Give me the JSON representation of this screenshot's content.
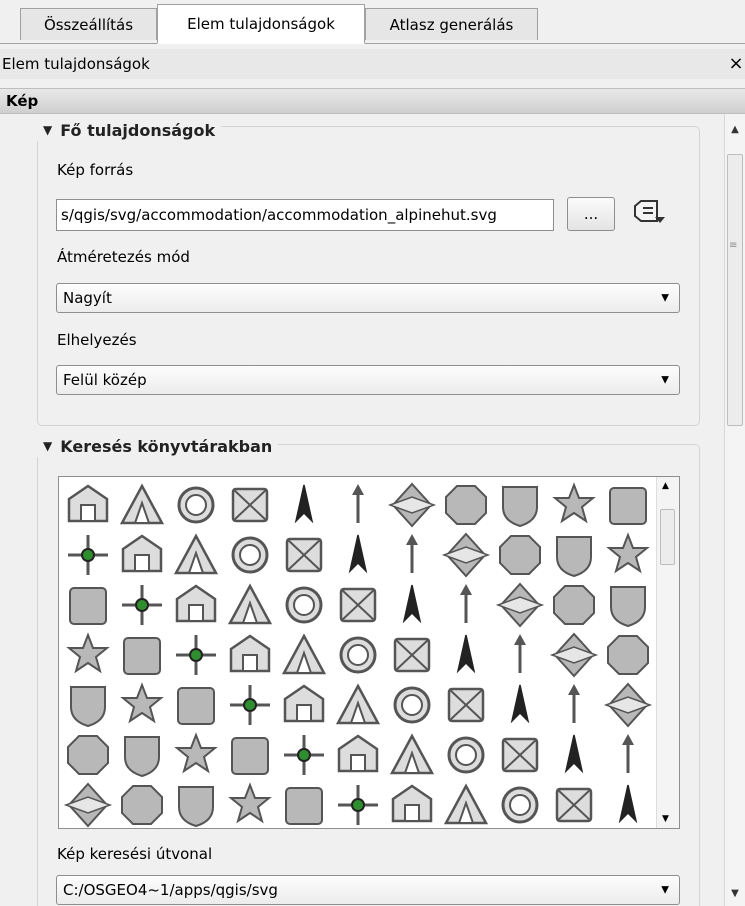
{
  "tabs": [
    {
      "label": "Összeállítás"
    },
    {
      "label": "Elem tulajdonságok"
    },
    {
      "label": "Atlasz generálás"
    }
  ],
  "dock": {
    "title": "Elem tulajdonságok",
    "close": "×"
  },
  "section": {
    "title": "Kép"
  },
  "main_props": {
    "title": "Fő tulajdonságok",
    "source_label": "Kép forrás",
    "source_value": "s/qgis/svg/accommodation/accommodation_alpinehut.svg",
    "browse_label": "...",
    "resize_label": "Átméretezés mód",
    "resize_value": "Nagyít",
    "placement_label": "Elhelyezés",
    "placement_value": "Felül közép"
  },
  "search": {
    "title": "Keresés könyvtárakban",
    "path_label": "Kép keresési útvonal",
    "path_value": "C:/OSGEO4~1/apps/qgis/svg"
  },
  "icons": {
    "grid": [
      [
        "alpinehut",
        "bed-breakfast",
        "camping",
        "caravan-park",
        "chalet",
        "hotel",
        "house",
        "shelter1",
        "shelter2",
        "youth-hostel",
        "bench"
      ],
      [
        "court",
        "fire",
        "firestation1",
        "firestation2",
        "fountain",
        "info",
        "library",
        "police",
        "police2",
        "post-box",
        "post-office"
      ],
      [
        "prison",
        "recycling",
        "survey-point",
        "telephone",
        "toilets",
        "toilets-disabled",
        "toilets-men",
        "toilets-women",
        "waste-basket",
        "arrow-up",
        "arrow-nav"
      ],
      [
        "north-arrow1",
        "north-arrow2",
        "north-arrow3",
        "north-arrow4",
        "north-arrow5",
        "north-arrow6",
        "north-arrow7",
        "north-arrow8",
        "compass-star1",
        "compass-star2",
        "compass-star3"
      ],
      [
        "north-arrow9",
        "north-arrow10",
        "north-arrow11",
        "north-arrow12",
        "circle",
        "no-entry",
        "octagon",
        "badge",
        "shield",
        "star",
        "square"
      ],
      [
        "rounded-square",
        "diamond",
        "diamond2",
        "triangle",
        "arc",
        "cross-road",
        "cross-dot",
        "x-mark",
        "x-box",
        "x-box2",
        "asterisk"
      ],
      [
        "tree-black",
        "tree-blue",
        "flames",
        "tee",
        "cup",
        "funnel",
        "box",
        "device",
        "quarter",
        "bowl",
        "cutlery"
      ]
    ]
  }
}
